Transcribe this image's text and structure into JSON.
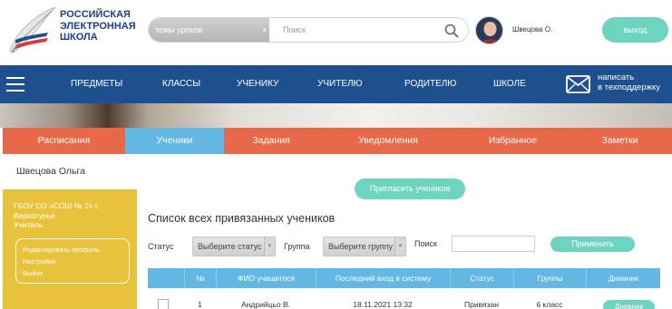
{
  "logo": {
    "lines": [
      "РОССИЙСКАЯ",
      "ЭЛЕКТРОННАЯ",
      "ШКОЛА"
    ],
    "icon": "quill-icon"
  },
  "search": {
    "topics_placeholder": "темы уроков",
    "clear_label": "×",
    "placeholder": "Поиск",
    "icon": "search-icon"
  },
  "user": {
    "name": "Швецова О.",
    "avatar_icon": "avatar-icon"
  },
  "logout_label": "выход",
  "nav": {
    "menu_icon": "hamburger-icon",
    "items": [
      "ПРЕДМЕТЫ",
      "КЛАССЫ",
      "УЧЕНИКУ",
      "УЧИТЕЛЮ",
      "РОДИТЕЛЮ",
      "ШКОЛЕ"
    ],
    "support_icon": "envelope-icon",
    "support_lines": [
      "написать",
      "в техподдержку"
    ]
  },
  "tabs": {
    "items": [
      "Расписания",
      "Ученики",
      "Задания",
      "Уведомления",
      "Избранное",
      "Заметки"
    ],
    "active": "Ученики"
  },
  "profile": {
    "name": "Швецова Ольга",
    "school": "ГБОУ СО «СОШ № 2» г. Верхотурье",
    "role": "Учитель",
    "links": [
      "Редактировать профиль",
      "Настройки",
      "Выйти"
    ]
  },
  "invite_label": "Пригласить учеников",
  "list": {
    "title": "Список всех привязанных учеников",
    "filters": {
      "status_label": "Статус",
      "status_value": "Выберите статус",
      "group_label": "Группа",
      "group_value": "Выберите группу",
      "search_label": "Поиск",
      "search_value": "",
      "apply_label": "Применить"
    },
    "columns": [
      "№",
      "ФИО учащегося",
      "Последний вход в систему",
      "Статус",
      "Группы",
      "Дневник"
    ],
    "rows": [
      {
        "num": "1",
        "name": "Андрийцьо В.",
        "last_login": "18.11.2021 13:32",
        "status": "Привязан",
        "groups": "6 класс",
        "diary_label": "Дневник"
      }
    ]
  },
  "colors": {
    "brand_blue": "#1e4f8f",
    "tab_orange": "#e8694a",
    "tab_active_blue": "#62b7e3",
    "accent_teal": "#6dd4c2",
    "card_yellow": "#e9c23b"
  }
}
